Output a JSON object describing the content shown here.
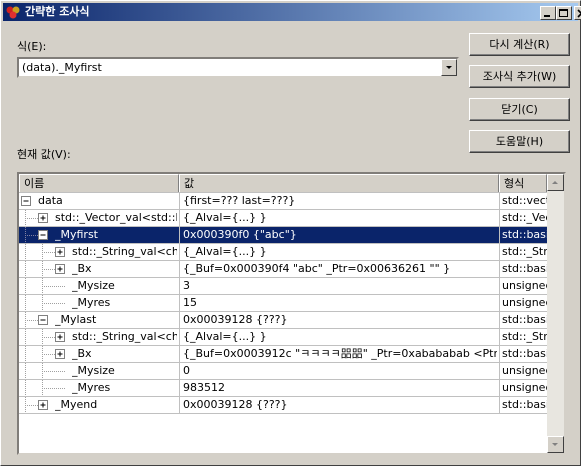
{
  "window": {
    "title": "간략한 조사식"
  },
  "expression": {
    "label": "식(E):",
    "value": "(data)._Myfirst"
  },
  "buttons": {
    "recalc": "다시 계산(R)",
    "add_watch": "조사식 추가(W)",
    "close": "닫기(C)",
    "help": "도움말(H)"
  },
  "current_value_label": "현재 값(V):",
  "grid": {
    "columns": [
      "이름",
      "값",
      "형식"
    ],
    "rows": [
      {
        "name": "data",
        "value": "{first=??? last=???}",
        "type": "std::vect"
      },
      {
        "name": "std::_Vector_val<std::b",
        "value": "{_Alval={...} }",
        "type": "std::_Vec"
      },
      {
        "name": "_Myfirst",
        "value": "0x000390f0 {\"abc\"}",
        "type": "std::basi"
      },
      {
        "name": "std::_String_val<ch",
        "value": "{_Alval={...} }",
        "type": "std::_Stri"
      },
      {
        "name": "_Bx",
        "value": "{_Buf=0x000390f4 \"abc\" _Ptr=0x00636261 \"\" }",
        "type": "std::basi"
      },
      {
        "name": "_Mysize",
        "value": "3",
        "type": "unsignec"
      },
      {
        "name": "_Myres",
        "value": "15",
        "type": "unsignec"
      },
      {
        "name": "_Mylast",
        "value": "0x00039128 {???}",
        "type": "std::basi"
      },
      {
        "name": "std::_String_val<ch",
        "value": "{_Alval={...} }",
        "type": "std::_Stri"
      },
      {
        "name": "_Bx",
        "value": "{_Buf=0x0003912c \"ㅋㅋㅋㅋ㗊㗊\" _Ptr=0xabababab <Ptr",
        "type": "std::basi"
      },
      {
        "name": "_Mysize",
        "value": "0",
        "type": "unsignec"
      },
      {
        "name": "_Myres",
        "value": "983512",
        "type": "unsignec"
      },
      {
        "name": "_Myend",
        "value": "0x00039128 {???}",
        "type": "std::basi"
      }
    ]
  },
  "colors": {
    "title_start": "#0a246a",
    "title_end": "#a6caf0",
    "selection": "#0a246a",
    "face": "#d4d0c8"
  }
}
